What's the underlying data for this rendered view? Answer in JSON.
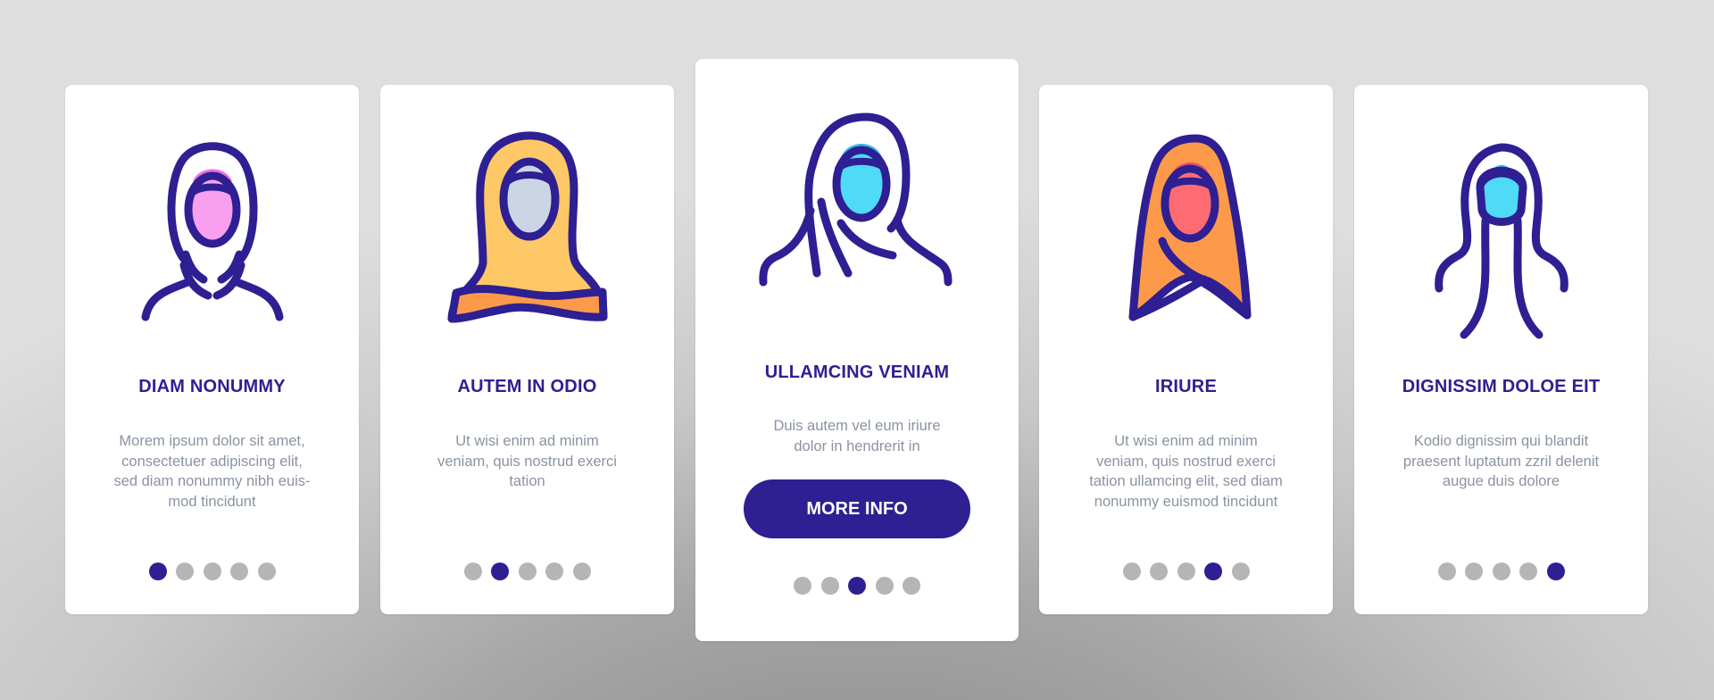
{
  "colors": {
    "primary": "#2e1f92",
    "dot_inactive": "#b5b5b5",
    "body_text": "#8a93a3",
    "card_bg": "#ffffff"
  },
  "cards": [
    {
      "icon": "hijab-simple-icon",
      "icon_colors": {
        "face": "#f99ff0",
        "forehead": "#ec6ee0"
      },
      "title": "DIAM NONUMMY",
      "body": "Morem ipsum dolor sit amet, consectetuer adipiscing elit, sed diam nonummy nibh euis-mod tincidunt",
      "body_lines": [
        "Morem ipsum dolor sit amet,",
        "consectetuer adipiscing elit,",
        "sed diam nonummy nibh euis-",
        "mod tincidunt"
      ],
      "active_dot": 1,
      "total_dots": 5
    },
    {
      "icon": "hijab-wrapped-icon",
      "icon_colors": {
        "face": "#cbd5e6",
        "forehead": "#8e9bb0",
        "scarf": "#fdc865",
        "band": "#fd9a4a"
      },
      "title": "AUTEM IN ODIO",
      "body_lines": [
        "Ut wisi enim ad minim",
        "veniam, quis nostrud exerci",
        "tation"
      ],
      "active_dot": 2,
      "total_dots": 5
    },
    {
      "icon": "hijab-draped-icon",
      "icon_colors": {
        "face": "#4fdaf8",
        "forehead": "#3cb8e8"
      },
      "title": "ULLAMCING VENIAM",
      "body_lines": [
        "Duis autem vel eum iriure",
        "dolor in hendrerit in"
      ],
      "button_label": "MORE INFO",
      "active_dot": 3,
      "total_dots": 5
    },
    {
      "icon": "hijab-pointed-icon",
      "icon_colors": {
        "face": "#ff6b72",
        "forehead": "#e8506a",
        "scarf": "#fd9a4a"
      },
      "title": "IRIURE",
      "body_lines": [
        "Ut wisi enim ad minim",
        "veniam, quis nostrud exerci",
        "tation ullamcing elit, sed diam",
        "nonummy euismod tincidunt"
      ],
      "active_dot": 4,
      "total_dots": 5
    },
    {
      "icon": "hijab-long-icon",
      "icon_colors": {
        "face": "#4fdaf8",
        "forehead": "#3cb8e8"
      },
      "title": "DIGNISSIM DOLOE EIT",
      "body_lines": [
        "Kodio dignissim qui blandit",
        "praesent luptatum zzril delenit",
        "augue duis dolore"
      ],
      "active_dot": 5,
      "total_dots": 5
    }
  ]
}
